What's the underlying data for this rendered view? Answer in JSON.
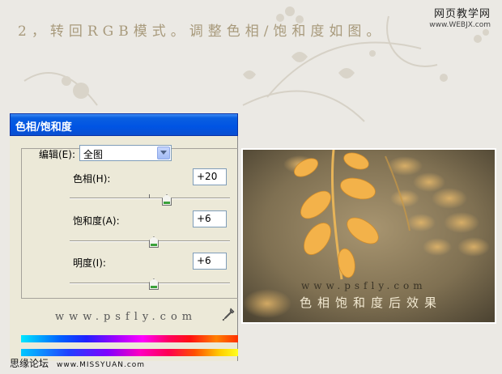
{
  "instruction": "2，转回RGB模式。调整色相/饱和度如图。",
  "site_logo": {
    "line1": "网页教学网",
    "line2": "www.WEBJX.com"
  },
  "dialog": {
    "title": "色相/饱和度",
    "edit_label": "编辑(E):",
    "edit_value": "全图",
    "hue": {
      "label": "色相(H):",
      "value": "+20",
      "level": 20
    },
    "saturation": {
      "label": "饱和度(A):",
      "value": "+6",
      "level": 6
    },
    "lightness": {
      "label": "明度(I):",
      "value": "+6",
      "level": 6
    },
    "watermark": "www.psfly.com"
  },
  "photo": {
    "site": "www.psfly.com",
    "caption": "色相饱和度后效果"
  },
  "footer": {
    "forum": "思缘论坛",
    "url": "www.MISSYUAN.com"
  },
  "colors": {
    "titlebar": "#0054e3",
    "dialog_bg": "#ece9d8",
    "leaf": "#f3b24a"
  },
  "icons": {
    "eyedropper": "eyedropper-icon",
    "dropdown": "chevron-down-icon"
  }
}
